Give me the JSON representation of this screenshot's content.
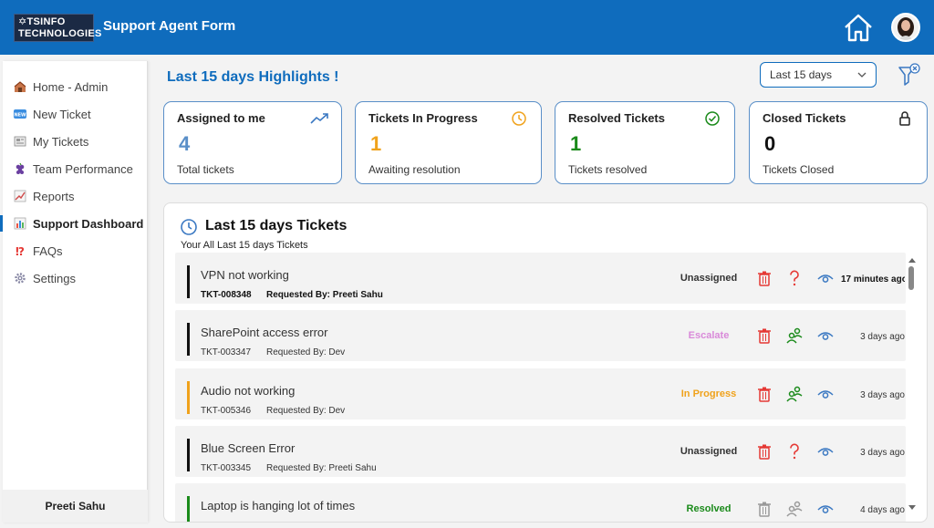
{
  "header": {
    "logo_line1": "✡TSINFO",
    "logo_line2": "TECHNOLOGIES",
    "title": "Support Agent Form"
  },
  "sidebar": {
    "items": [
      {
        "label": "Home - Admin",
        "icon": "home-emoji-icon"
      },
      {
        "label": "New Ticket",
        "icon": "new-badge-icon"
      },
      {
        "label": "My Tickets",
        "icon": "newspaper-icon"
      },
      {
        "label": "Team Performance",
        "icon": "grapes-icon"
      },
      {
        "label": "Reports",
        "icon": "chart-increasing-icon"
      },
      {
        "label": "Support Dashboard",
        "icon": "bar-chart-icon"
      },
      {
        "label": "FAQs",
        "icon": "exclamation-question-icon"
      },
      {
        "label": "Settings",
        "icon": "gear-icon"
      }
    ],
    "user_name": "Preeti Sahu"
  },
  "highlights": {
    "title": "Last 15 days Highlights !",
    "range_value": "Last 15 days",
    "cards": [
      {
        "title": "Assigned to me",
        "value": "4",
        "subtitle": "Total tickets",
        "color": "#5a8fc8"
      },
      {
        "title": "Tickets In Progress",
        "value": "1",
        "subtitle": "Awaiting resolution",
        "color": "#f0a21b"
      },
      {
        "title": "Resolved Tickets",
        "value": "1",
        "subtitle": "Tickets resolved",
        "color": "#1a8a1a"
      },
      {
        "title": "Closed Tickets",
        "value": "0",
        "subtitle": "Tickets Closed",
        "color": "#111111"
      }
    ]
  },
  "tickets": {
    "title": "Last 15 days Tickets",
    "subtitle": "Your All Last 15 days Tickets",
    "rows": [
      {
        "title": "VPN not working",
        "id": "TKT-008348",
        "requested_by": "Requested By: Preeti Sahu",
        "status": "Unassigned",
        "status_color": "#333333",
        "bar_color": "#111111",
        "time": "17 minutes ago",
        "action": "question"
      },
      {
        "title": "SharePoint access error",
        "id": "TKT-003347",
        "requested_by": "Requested By: Dev",
        "status": "Escalate",
        "status_color": "#d98ad9",
        "bar_color": "#111111",
        "time": "3 days ago",
        "action": "assign"
      },
      {
        "title": "Audio not working",
        "id": "TKT-005346",
        "requested_by": "Requested By: Dev",
        "status": "In Progress",
        "status_color": "#f0a21b",
        "bar_color": "#f0a21b",
        "time": "3 days ago",
        "action": "assign"
      },
      {
        "title": "Blue Screen Error",
        "id": "TKT-003345",
        "requested_by": "Requested By: Preeti Sahu",
        "status": "Unassigned",
        "status_color": "#333333",
        "bar_color": "#111111",
        "time": "3 days ago",
        "action": "question"
      },
      {
        "title": "Laptop is hanging lot of times",
        "id": "",
        "requested_by": "",
        "status": "Resolved",
        "status_color": "#1a8a1a",
        "bar_color": "#1a8a1a",
        "time": "4 days ago",
        "action": "assign-disabled"
      }
    ]
  },
  "colors": {
    "brand": "#0f6cbd",
    "delete": "#e53935",
    "question": "#e53935",
    "assign": "#1a8a1a",
    "view": "#3a78c2"
  }
}
